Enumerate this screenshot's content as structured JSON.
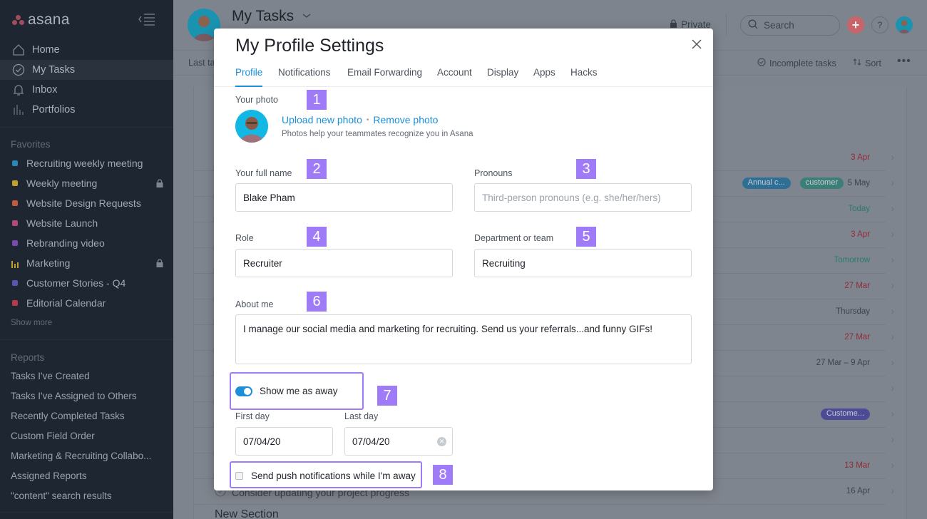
{
  "sidebar": {
    "logo_text": "asana",
    "nav": [
      {
        "label": "Home",
        "icon": "home-icon"
      },
      {
        "label": "My Tasks",
        "icon": "check-circle-icon",
        "active": true
      },
      {
        "label": "Inbox",
        "icon": "bell-icon"
      },
      {
        "label": "Portfolios",
        "icon": "bar-chart-icon"
      }
    ],
    "favorites_title": "Favorites",
    "favorites": [
      {
        "label": "Recruiting weekly meeting",
        "color": "#2a85b8",
        "locked": false
      },
      {
        "label": "Weekly meeting",
        "color": "#c0a22a",
        "locked": true
      },
      {
        "label": "Website Design Requests",
        "color": "#c45a3c",
        "locked": false
      },
      {
        "label": "Website Launch",
        "color": "#b24a7a",
        "locked": false
      },
      {
        "label": "Rebranding video",
        "color": "#7a4ab0",
        "locked": false
      },
      {
        "label": "Marketing",
        "color": "#c0a22a",
        "locked": true,
        "icon": "bar-chart-icon"
      },
      {
        "label": "Customer Stories - Q4",
        "color": "#5a55b0",
        "locked": false
      },
      {
        "label": "Editorial Calendar",
        "color": "#b8384c",
        "locked": false
      }
    ],
    "show_more": "Show more",
    "reports_title": "Reports",
    "reports": [
      "Tasks I've Created",
      "Tasks I've Assigned to Others",
      "Recently Completed Tasks",
      "Custom Field Order",
      "Marketing & Recruiting Collabo...",
      "Assigned Reports",
      "\"content\" search results"
    ]
  },
  "header": {
    "title": "My Tasks",
    "private_label": "Private",
    "search_placeholder": "Search",
    "help_label": "?",
    "plus_label": "+"
  },
  "toolbar": {
    "last_label": "Last ta",
    "incomplete_label": "Incomplete tasks",
    "sort_label": "Sort",
    "more_label": "•••"
  },
  "tasks": [
    {
      "date": "3 Apr",
      "date_color": "#8f2c3a",
      "tags": []
    },
    {
      "date": "5 May",
      "date_color": "#3d434b",
      "tags": [
        {
          "label": "Annual c...",
          "color": "#2f6f95"
        },
        {
          "label": "customer",
          "color": "#3c7f78"
        }
      ]
    },
    {
      "date": "Today",
      "date_color": "#2a7a6e",
      "tags": []
    },
    {
      "date": "3 Apr",
      "date_color": "#8f2c3a",
      "tags": []
    },
    {
      "date": "Tomorrow",
      "date_color": "#2a7a6e",
      "tags": []
    },
    {
      "date": "27 Mar",
      "date_color": "#8f2c3a",
      "tags": []
    },
    {
      "date": "Thursday",
      "date_color": "#3d434b",
      "tags": []
    },
    {
      "date": "27 Mar",
      "date_color": "#8f2c3a",
      "tags": []
    },
    {
      "date": "27 Mar – 9 Apr",
      "date_color": "#3d434b",
      "tags": []
    },
    {
      "date": "",
      "date_color": "#3d434b",
      "tags": []
    },
    {
      "date": "",
      "date_color": "#3d434b",
      "tags": [
        {
          "label": "Custome...",
          "color": "#4e4b96"
        }
      ]
    },
    {
      "date": "",
      "date_color": "#3d434b",
      "tags": []
    },
    {
      "date": "13 Mar",
      "date_color": "#8f2c3a",
      "tags": []
    },
    {
      "date": "16 Apr",
      "date_color": "#3d434b",
      "tags": []
    }
  ],
  "bottom_task": "Consider updating your project progress",
  "new_section": "New Section",
  "modal": {
    "title": "My Profile Settings",
    "tabs": [
      "Profile",
      "Notifications",
      "Email Forwarding",
      "Account",
      "Display",
      "Apps",
      "Hacks"
    ],
    "active_tab": "Profile",
    "photo_label": "Your photo",
    "upload_link": "Upload new photo",
    "remove_link": "Remove photo",
    "link_sep": "•",
    "photo_help": "Photos help your teammates recognize you in Asana",
    "full_name_label": "Your full name",
    "full_name_value": "Blake Pham",
    "pronouns_label": "Pronouns",
    "pronouns_placeholder": "Third-person pronouns (e.g. she/her/hers)",
    "role_label": "Role",
    "role_value": "Recruiter",
    "department_label": "Department or team",
    "department_value": "Recruiting",
    "about_label": "About me",
    "about_value": "I manage our social media and marketing for recruiting. Send us your referrals...and funny GIFs!",
    "away_label": "Show me as away",
    "away_on": true,
    "first_day_label": "First day",
    "first_day_value": "07/04/20",
    "last_day_label": "Last day",
    "last_day_value": "07/04/20",
    "push_label": "Send push notifications while I'm away",
    "push_checked": false
  },
  "annotations": [
    "1",
    "2",
    "3",
    "4",
    "5",
    "6",
    "7",
    "8"
  ]
}
